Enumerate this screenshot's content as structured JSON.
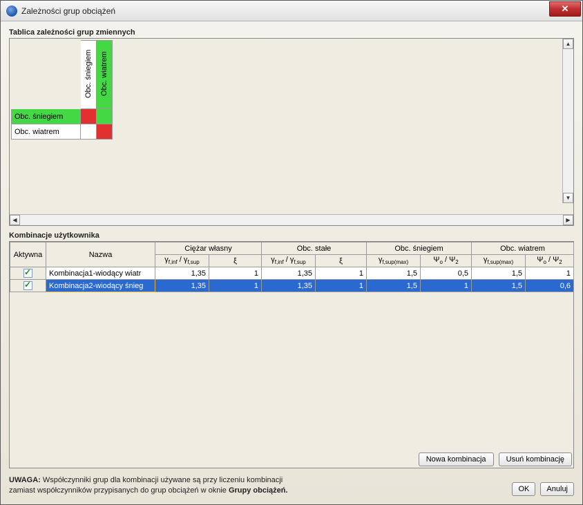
{
  "window": {
    "title": "Zależności grup obciążeń"
  },
  "matrix": {
    "label": "Tablica zależności grup zmiennych",
    "cols": [
      "Obc. śniegiem",
      "Obc. wiatrem"
    ],
    "rows": [
      "Obc. śniegiem",
      "Obc. wiatrem"
    ]
  },
  "comb": {
    "label": "Kombinacje użytkownika",
    "headers": {
      "active": "Aktywna",
      "name": "Nazwa",
      "group1": "Ciężar własny",
      "group2": "Obc. stałe",
      "group3": "Obc. śniegiem",
      "group4": "Obc. wiatrem",
      "gamma": "γ",
      "finf": "f,inf",
      "fsup": "f,sup",
      "fsup_max": "f,sup(max)",
      "xi": "ξ",
      "psi": "Ψ",
      "psi_o": "o",
      "psi_2": "2"
    },
    "rows": [
      {
        "active": true,
        "name": "Kombinacja1-wiodący wiatr",
        "v1": "1,35",
        "v2": "1",
        "v3": "1,35",
        "v4": "1",
        "v5": "1,5",
        "v6": "0,5",
        "v7": "1,5",
        "v8": "1"
      },
      {
        "active": true,
        "name": "Kombinacja2-wiodący śnieg",
        "v1": "1,35",
        "v2": "1",
        "v3": "1,35",
        "v4": "1",
        "v5": "1,5",
        "v6": "1",
        "v7": "1,5",
        "v8": "0,6"
      }
    ]
  },
  "buttons": {
    "new": "Nowa kombinacja",
    "del": "Usuń kombinację",
    "ok": "OK",
    "cancel": "Anuluj"
  },
  "note": {
    "prefix": "UWAGA:",
    "line1": " Współczynniki grup dla kombinacji używane są przy liczeniu kombinacji",
    "line2": "zamiast współczynników przypisanych do grup obciążeń w oknie ",
    "bold2": "Grupy obciążeń."
  }
}
